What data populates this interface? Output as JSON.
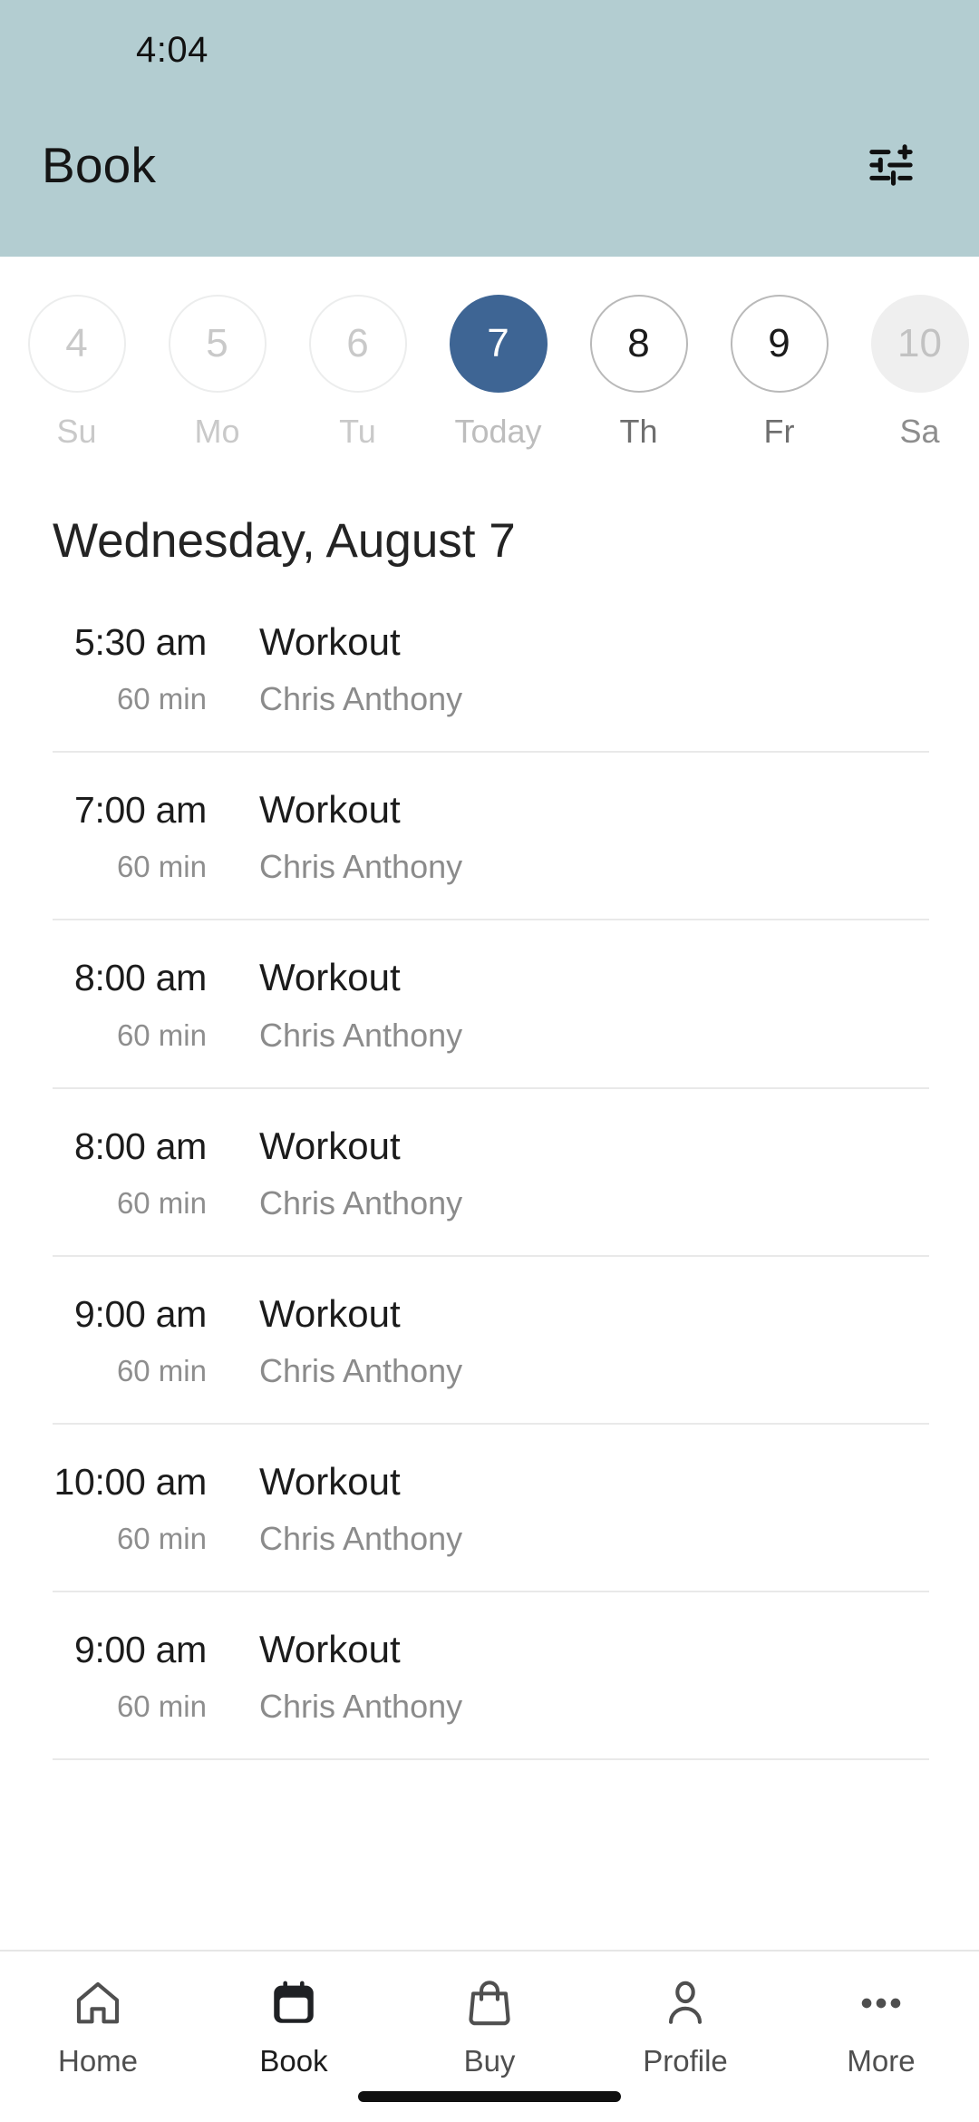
{
  "statusbar": {
    "time": "4:04"
  },
  "header": {
    "title": "Book",
    "background": "#b3cdd1",
    "filter_icon": "tune-icon"
  },
  "date_strip": {
    "days": [
      {
        "num": "4",
        "label": "Su",
        "state": "past"
      },
      {
        "num": "5",
        "label": "Mo",
        "state": "past"
      },
      {
        "num": "6",
        "label": "Tu",
        "state": "past"
      },
      {
        "num": "7",
        "label": "Today",
        "state": "selected"
      },
      {
        "num": "8",
        "label": "Th",
        "state": "active"
      },
      {
        "num": "9",
        "label": "Fr",
        "state": "active"
      },
      {
        "num": "10",
        "label": "Sa",
        "state": "muted"
      }
    ],
    "selected_color": "#3e6594"
  },
  "schedule": {
    "date_heading": "Wednesday, August 7",
    "slots": [
      {
        "time": "5:30 am",
        "duration": "60 min",
        "title": "Workout",
        "instructor": "Chris Anthony"
      },
      {
        "time": "7:00 am",
        "duration": "60 min",
        "title": "Workout",
        "instructor": "Chris Anthony"
      },
      {
        "time": "8:00 am",
        "duration": "60 min",
        "title": "Workout",
        "instructor": "Chris Anthony"
      },
      {
        "time": "8:00 am",
        "duration": "60 min",
        "title": "Workout",
        "instructor": "Chris Anthony"
      },
      {
        "time": "9:00 am",
        "duration": "60 min",
        "title": "Workout",
        "instructor": "Chris Anthony"
      },
      {
        "time": "10:00 am",
        "duration": "60 min",
        "title": "Workout",
        "instructor": "Chris Anthony"
      },
      {
        "time": "9:00 am",
        "duration": "60 min",
        "title": "Workout",
        "instructor": "Chris Anthony"
      }
    ]
  },
  "bottom_nav": {
    "items": [
      {
        "label": "Home",
        "icon": "home-icon",
        "selected": false
      },
      {
        "label": "Book",
        "icon": "calendar-icon",
        "selected": true
      },
      {
        "label": "Buy",
        "icon": "bag-icon",
        "selected": false
      },
      {
        "label": "Profile",
        "icon": "person-icon",
        "selected": false
      },
      {
        "label": "More",
        "icon": "ellipsis-icon",
        "selected": false
      }
    ]
  }
}
